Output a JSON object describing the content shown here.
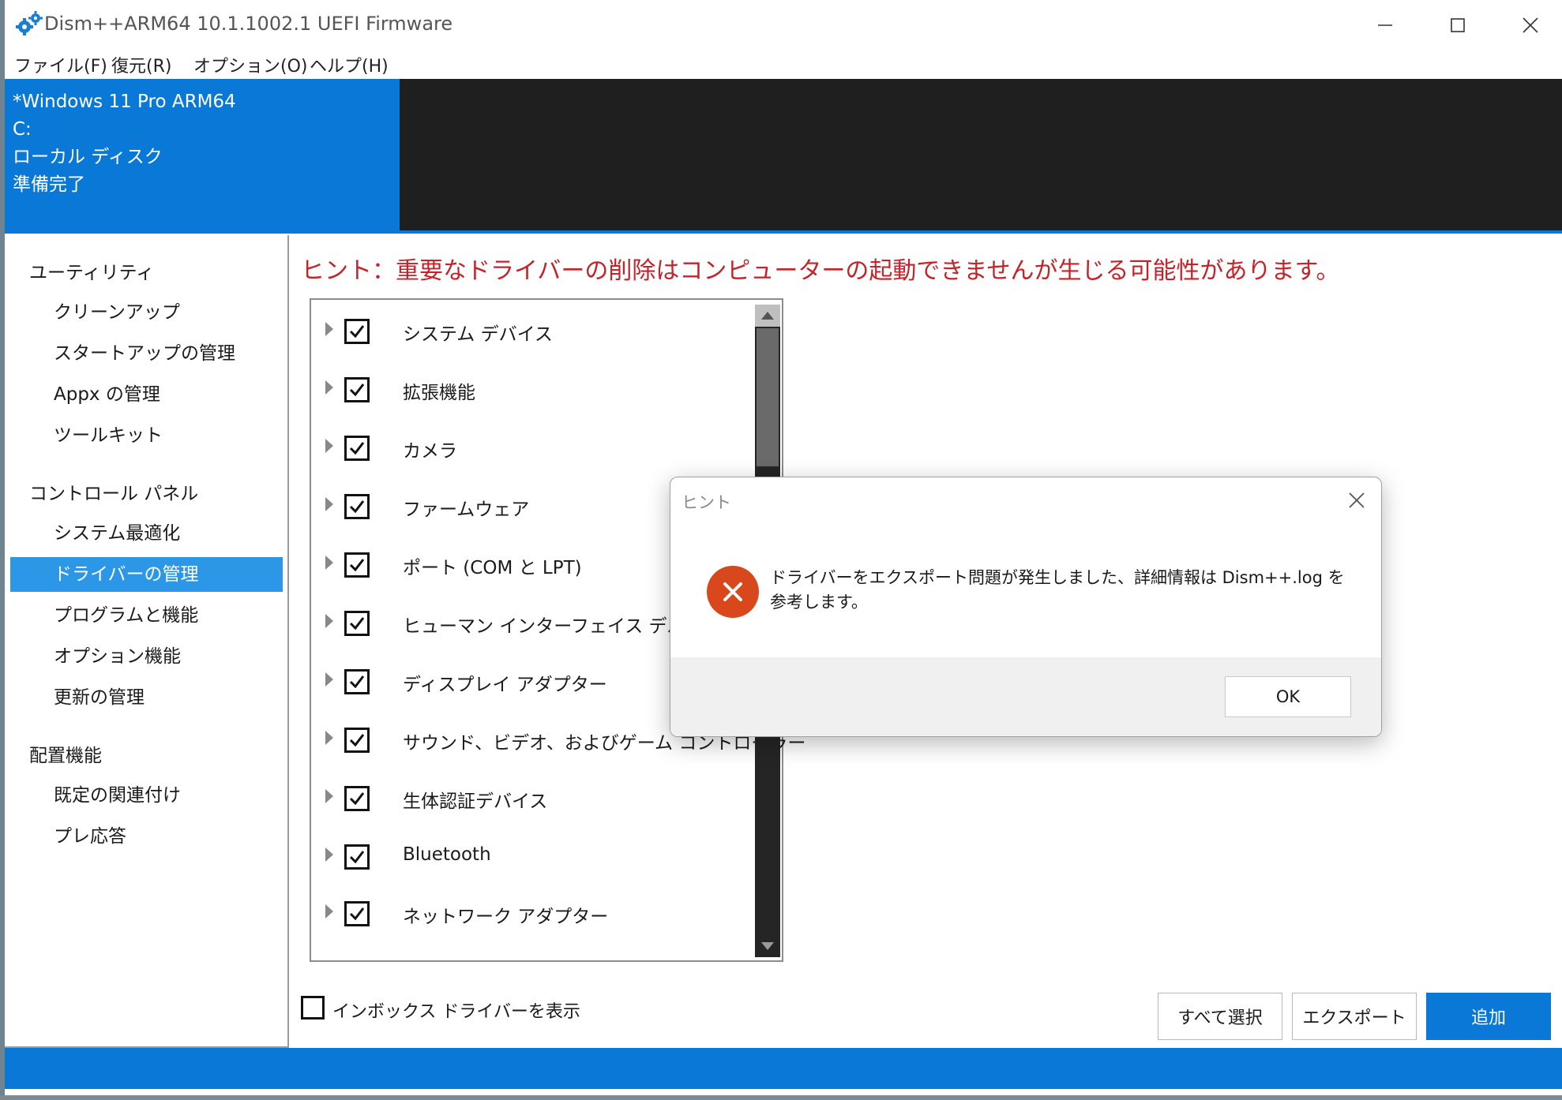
{
  "window": {
    "title": "Dism++ARM64 10.1.1002.1 UEFI Firmware",
    "icon": "gears-icon"
  },
  "menu": [
    "ファイル(F)",
    "復元(R)",
    "オプション(O)",
    "ヘルプ(H)"
  ],
  "image_card": {
    "name": "*Windows 11 Pro ARM64",
    "drive": "C:",
    "type": "ローカル ディスク",
    "status": "準備完了"
  },
  "sidebar": {
    "groups": [
      {
        "heading": "ユーティリティ",
        "items": [
          "クリーンアップ",
          "スタートアップの管理",
          "Appx の管理",
          "ツールキット"
        ]
      },
      {
        "heading": "コントロール パネル",
        "items": [
          "システム最適化",
          "ドライバーの管理",
          "プログラムと機能",
          "オプション機能",
          "更新の管理"
        ]
      },
      {
        "heading": "配置機能",
        "items": [
          "既定の関連付け",
          "プレ応答"
        ]
      }
    ],
    "active_item": "ドライバーの管理"
  },
  "main": {
    "hint": "ヒント：重要なドライバーの削除はコンピューターの起動できませんが生じる可能性があります。",
    "drivers": [
      {
        "label": "システム デバイス",
        "checked": true
      },
      {
        "label": "拡張機能",
        "checked": true
      },
      {
        "label": "カメラ",
        "checked": true
      },
      {
        "label": "ファームウェア",
        "checked": true
      },
      {
        "label": "ポート (COM と LPT)",
        "checked": true
      },
      {
        "label": "ヒューマン インターフェイス デバイス",
        "checked": true
      },
      {
        "label": "ディスプレイ アダプター",
        "checked": true
      },
      {
        "label": "サウンド、ビデオ、およびゲーム コントローラー",
        "checked": true
      },
      {
        "label": "生体認証デバイス",
        "checked": true
      },
      {
        "label": "Bluetooth",
        "checked": true
      },
      {
        "label": "ネットワーク アダプター",
        "checked": true
      }
    ],
    "show_inbox_label": "インボックス ドライバーを表示",
    "show_inbox_checked": false,
    "buttons": {
      "select_all": "すべて選択",
      "export": "エクスポート",
      "add": "追加"
    }
  },
  "dialog": {
    "title": "ヒント",
    "message": "ドライバーをエクスポート問題が発生しました、詳細情報は Dism++.log を参考します。",
    "ok": "OK",
    "icon": "error-icon"
  },
  "colors": {
    "accent": "#0a78d7",
    "active_item": "#2b97e6",
    "hint_text": "#c4232a",
    "header_dark": "#1f1f1f",
    "error_icon": "#d9471c"
  }
}
